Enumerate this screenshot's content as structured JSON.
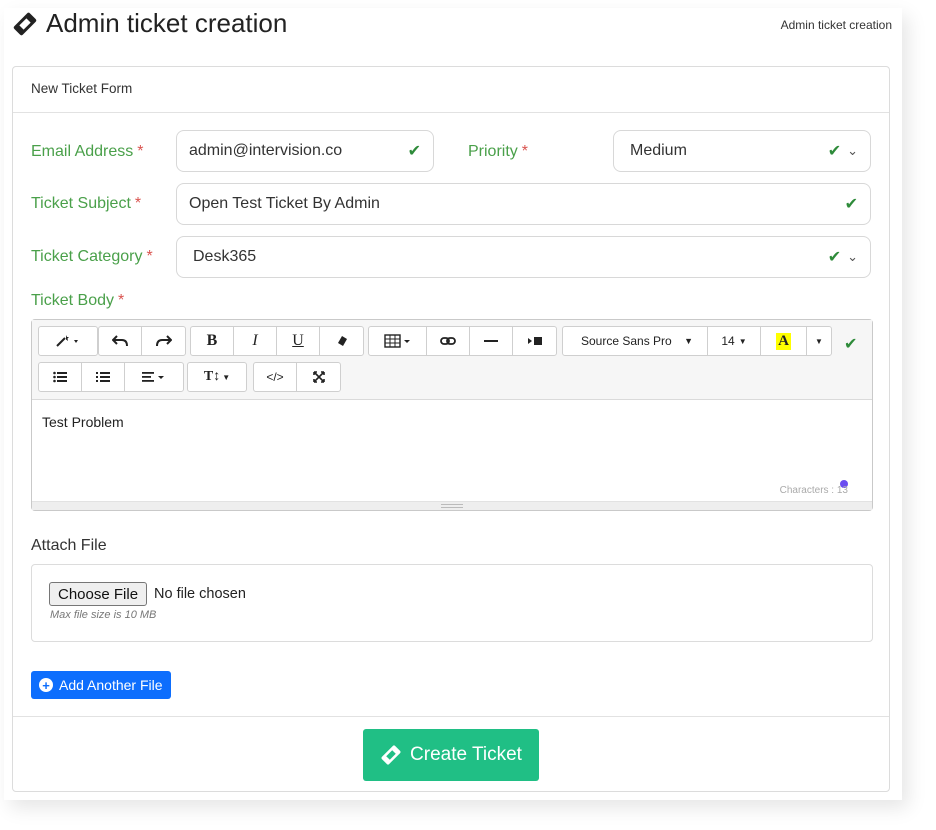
{
  "header": {
    "title": "Admin ticket creation",
    "breadcrumb": "Admin ticket creation"
  },
  "form": {
    "card_title": "New Ticket Form",
    "email": {
      "label": "Email Address",
      "required": "*",
      "value": "admin@intervision.co"
    },
    "priority": {
      "label": "Priority",
      "required": "*",
      "value": "Medium"
    },
    "subject": {
      "label": "Ticket Subject",
      "required": "*",
      "value": "Open Test Ticket By Admin"
    },
    "category": {
      "label": "Ticket Category",
      "required": "*",
      "value": "Desk365"
    },
    "body": {
      "label": "Ticket Body",
      "required": "*",
      "value": "Test Problem",
      "char_count": "Characters : 13"
    }
  },
  "editor_toolbar": {
    "font_family": "Source Sans Pro",
    "font_size": "14",
    "highlight_letter": "A",
    "bold": "B",
    "italic": "I",
    "underline": "U",
    "text_height": "T↕",
    "code": "</>"
  },
  "attach": {
    "label": "Attach File",
    "choose_button": "Choose File",
    "no_file": "No file chosen",
    "max_size": "Max file size is 10 MB",
    "add_another": "Add Another File"
  },
  "footer": {
    "create_button": "Create Ticket"
  },
  "colors": {
    "label_green": "#4aa04a",
    "check_green": "#2e8b3a",
    "primary_blue": "#0d6efd",
    "create_green": "#20bf85",
    "required_red": "#d9534f"
  }
}
